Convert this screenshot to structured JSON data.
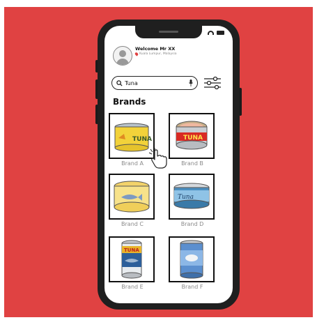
{
  "header": {
    "welcome": "Welcome Mr XX",
    "location": "Kuala Lumpur, Malaysia"
  },
  "search": {
    "value": "Tuna"
  },
  "section": {
    "title": "Brands"
  },
  "brands": [
    {
      "label": "Brand A"
    },
    {
      "label": "Brand B"
    },
    {
      "label": "Brand C"
    },
    {
      "label": "Brand D"
    },
    {
      "label": "Brand E"
    },
    {
      "label": "Brand F"
    }
  ],
  "can_labels": {
    "a": "TUNA",
    "b": "TUNA",
    "d": "Tuna",
    "e": "TUNA"
  },
  "colors": {
    "background": "#e04242",
    "phone": "#1f1f1f",
    "label_grey": "#8a8a8a"
  }
}
